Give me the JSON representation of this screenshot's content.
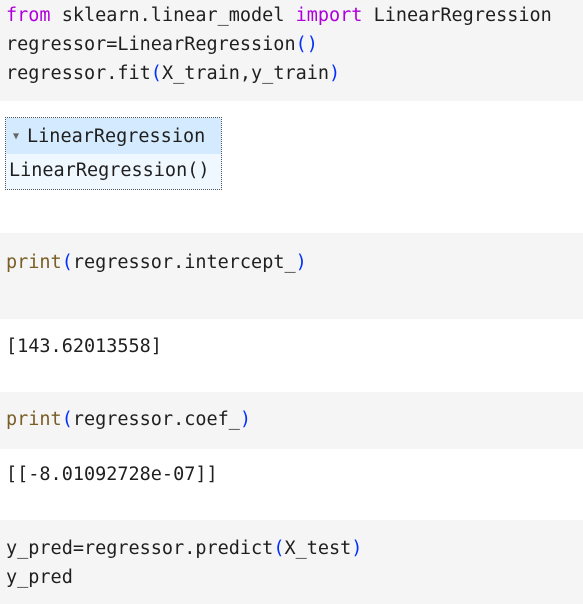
{
  "cells": [
    {
      "lines": [
        {
          "kw1": "from",
          "t1": " sklearn.linear_model ",
          "kw2": "import",
          "t2": " LinearRegression"
        },
        {
          "text": "regressor=LinearRegression",
          "p": "()"
        },
        {
          "a": "regressor.fit",
          "p1": "(",
          "b": "X_train,y_train",
          "p2": ")"
        }
      ]
    },
    {
      "fn": "print",
      "p1": "(",
      "arg": "regressor.intercept_",
      "p2": ")"
    },
    {
      "fn": "print",
      "p1": "(",
      "arg": "regressor.coef_",
      "p2": ")"
    },
    {
      "l1a": "y_pred=regressor.predict",
      "p1": "(",
      "l1b": "X_test",
      "p2": ")",
      "l2": "y_pred"
    }
  ],
  "widget": {
    "title": "LinearRegression",
    "body": "LinearRegression()",
    "icon": "triangle-down-icon"
  },
  "outputs": {
    "intercept": "[143.62013558]",
    "coef": "[[-8.01092728e-07]]"
  },
  "colors": {
    "keyword": "#af00db",
    "function": "#795e26",
    "paren": "#0431fa",
    "cell_bg": "#f5f5f5",
    "widget_header": "#d4ebff"
  }
}
